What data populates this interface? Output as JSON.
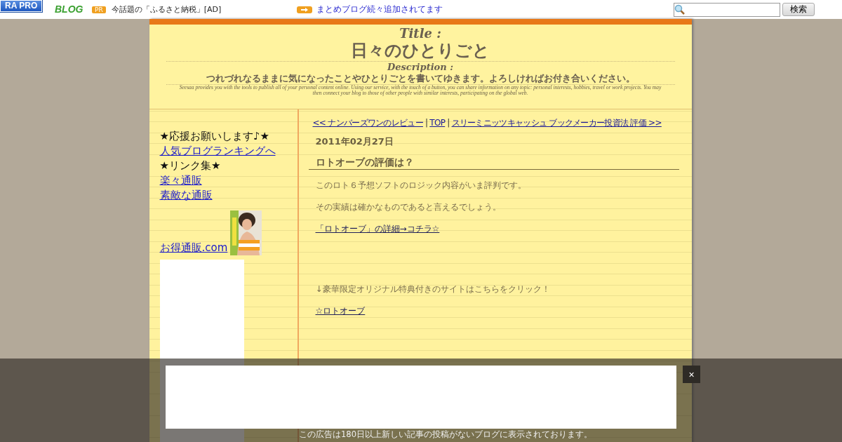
{
  "top_bar": {
    "badge": "RA PRO",
    "logo": "BLOG",
    "pr_tag": "PR",
    "pr_text": "今話題の「ふるさと納税」[AD]",
    "notice": "まとめブログ続々追加されてます",
    "search_button": "検索"
  },
  "header": {
    "title_label": "Title :",
    "title": "日々のひとりごと",
    "description_label": "Description :",
    "description": "つれづれなるままに気になったことやひとりごとを書いてゆきます。よろしければお付き合いください。",
    "fine_print": "Seesaa provides you with the tools to publish all of your personal content online. Using our service, with the touch of a button, you can share information on any topic: personal interests, hobbies, travel or work projects. You may then connect your blog to those of other people with similar interests, participating on the global web."
  },
  "sidebar": {
    "items": [
      {
        "kind": "text",
        "text": "★応援お願いします♪★"
      },
      {
        "kind": "link",
        "text": "人気ブログランキングへ"
      },
      {
        "kind": "text",
        "text": "★リンク集★"
      },
      {
        "kind": "link",
        "text": "楽々通販"
      },
      {
        "kind": "link",
        "text": "素敵な通販"
      },
      {
        "kind": "image_link",
        "text": "お得通販.com"
      }
    ]
  },
  "article": {
    "nav": [
      {
        "kind": "link",
        "text": "<< ナンバーズワンのレビュー"
      },
      {
        "kind": "separator",
        "text": "|"
      },
      {
        "kind": "link",
        "text": "TOP"
      },
      {
        "kind": "separator",
        "text": "|"
      },
      {
        "kind": "link",
        "text": "スリーミニッツキャッシュ ブックメーカー投資法 評価 >>"
      }
    ],
    "date": "2011年02月27日",
    "title": "ロトオーブの評価は？",
    "sections": [
      [
        {
          "kind": "text",
          "text": "このロト６予想ソフトのロジック内容がいま評判です。"
        },
        {
          "kind": "text",
          "text": "その実績は確かなものであると言えるでしょう。"
        },
        {
          "kind": "link",
          "text": "「ロトオーブ」の詳細→コチラ☆"
        }
      ],
      [
        {
          "kind": "text",
          "text": "↓豪華限定オリジナル特典付きのサイトはこちらをクリック！"
        },
        {
          "kind": "link",
          "text": "☆ロトオーブ"
        }
      ]
    ]
  },
  "ad_overlay": {
    "close": "×",
    "notice": "この広告は180日以上新しい記事の投稿がないブログに表示されております。"
  }
}
